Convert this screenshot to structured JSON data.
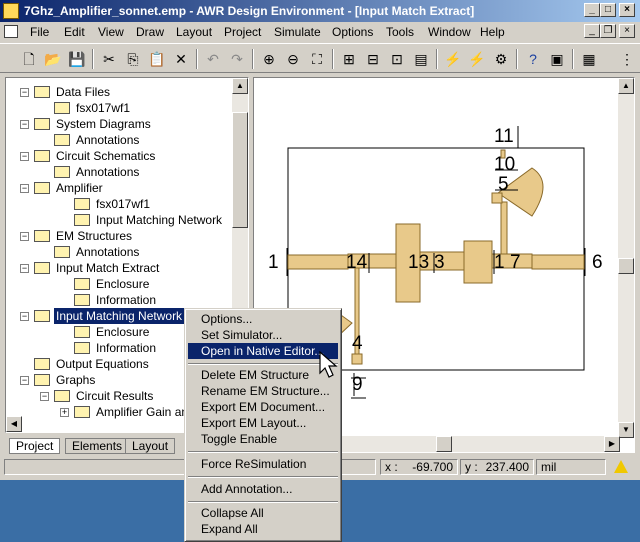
{
  "window": {
    "title": "7Ghz_Amplifier_sonnet.emp - AWR Design Environment - [Input Match Extract]"
  },
  "menubar": {
    "items": [
      "File",
      "Edit",
      "View",
      "Draw",
      "Layout",
      "Project",
      "Simulate",
      "Options",
      "Tools",
      "Window",
      "Help"
    ]
  },
  "tree": {
    "items": [
      {
        "label": "Data Files",
        "icon": "folder-icon"
      },
      {
        "label": "fsx017wf1",
        "icon": "data-file-icon"
      },
      {
        "label": "System Diagrams",
        "icon": "system-diagram-icon"
      },
      {
        "label": "Annotations",
        "icon": "annotation-icon"
      },
      {
        "label": "Circuit Schematics",
        "icon": "schematic-icon"
      },
      {
        "label": "Annotations",
        "icon": "annotation-icon"
      },
      {
        "label": "Amplifier",
        "icon": "schematic-icon"
      },
      {
        "label": "fsx017wf1",
        "icon": "data-file-icon"
      },
      {
        "label": "Input Matching Network",
        "icon": "subcircuit-icon"
      },
      {
        "label": "EM Structures",
        "icon": "em-structures-icon"
      },
      {
        "label": "Annotations",
        "icon": "annotation-icon"
      },
      {
        "label": "Input Match Extract",
        "icon": "em-structure-icon"
      },
      {
        "label": "Enclosure",
        "icon": "folder-icon"
      },
      {
        "label": "Information",
        "icon": "info-icon"
      },
      {
        "label": "Input Matching Network EM",
        "icon": "em-structure-icon"
      },
      {
        "label": "Enclosure",
        "icon": "folder-icon"
      },
      {
        "label": "Information",
        "icon": "info-icon"
      },
      {
        "label": "Output Equations",
        "icon": "equation-icon"
      },
      {
        "label": "Graphs",
        "icon": "graph-icon"
      },
      {
        "label": "Circuit Results",
        "icon": "folder-icon"
      },
      {
        "label": "Amplifier Gain and",
        "icon": "graph-icon"
      }
    ]
  },
  "tabs": [
    "Project",
    "Elements",
    "Layout"
  ],
  "layout_view": {
    "ports": [
      "1",
      "14",
      "13",
      "3",
      "1",
      "7",
      "6",
      "11",
      "10",
      "5",
      "4",
      "9"
    ]
  },
  "context_menu": {
    "items": [
      "Options...",
      "Set Simulator...",
      "Open in Native Editor...",
      "Delete EM Structure",
      "Rename EM Structure...",
      "Export EM Document...",
      "Export EM Layout...",
      "Toggle Enable",
      "Force ReSimulation",
      "Add Annotation...",
      "Collapse All",
      "Expand All"
    ],
    "highlighted": "Open in Native Editor..."
  },
  "status": {
    "x_label": "x :",
    "x_value": "-69.700",
    "y_label": "y :",
    "y_value": "237.400",
    "units": "mil"
  },
  "colors": {
    "title_start": "#0a246a",
    "title_end": "#a6caf0",
    "trace_fill": "#e8c98a",
    "trace_stroke": "#8a6a2a",
    "desktop": "#3a6ea5"
  }
}
